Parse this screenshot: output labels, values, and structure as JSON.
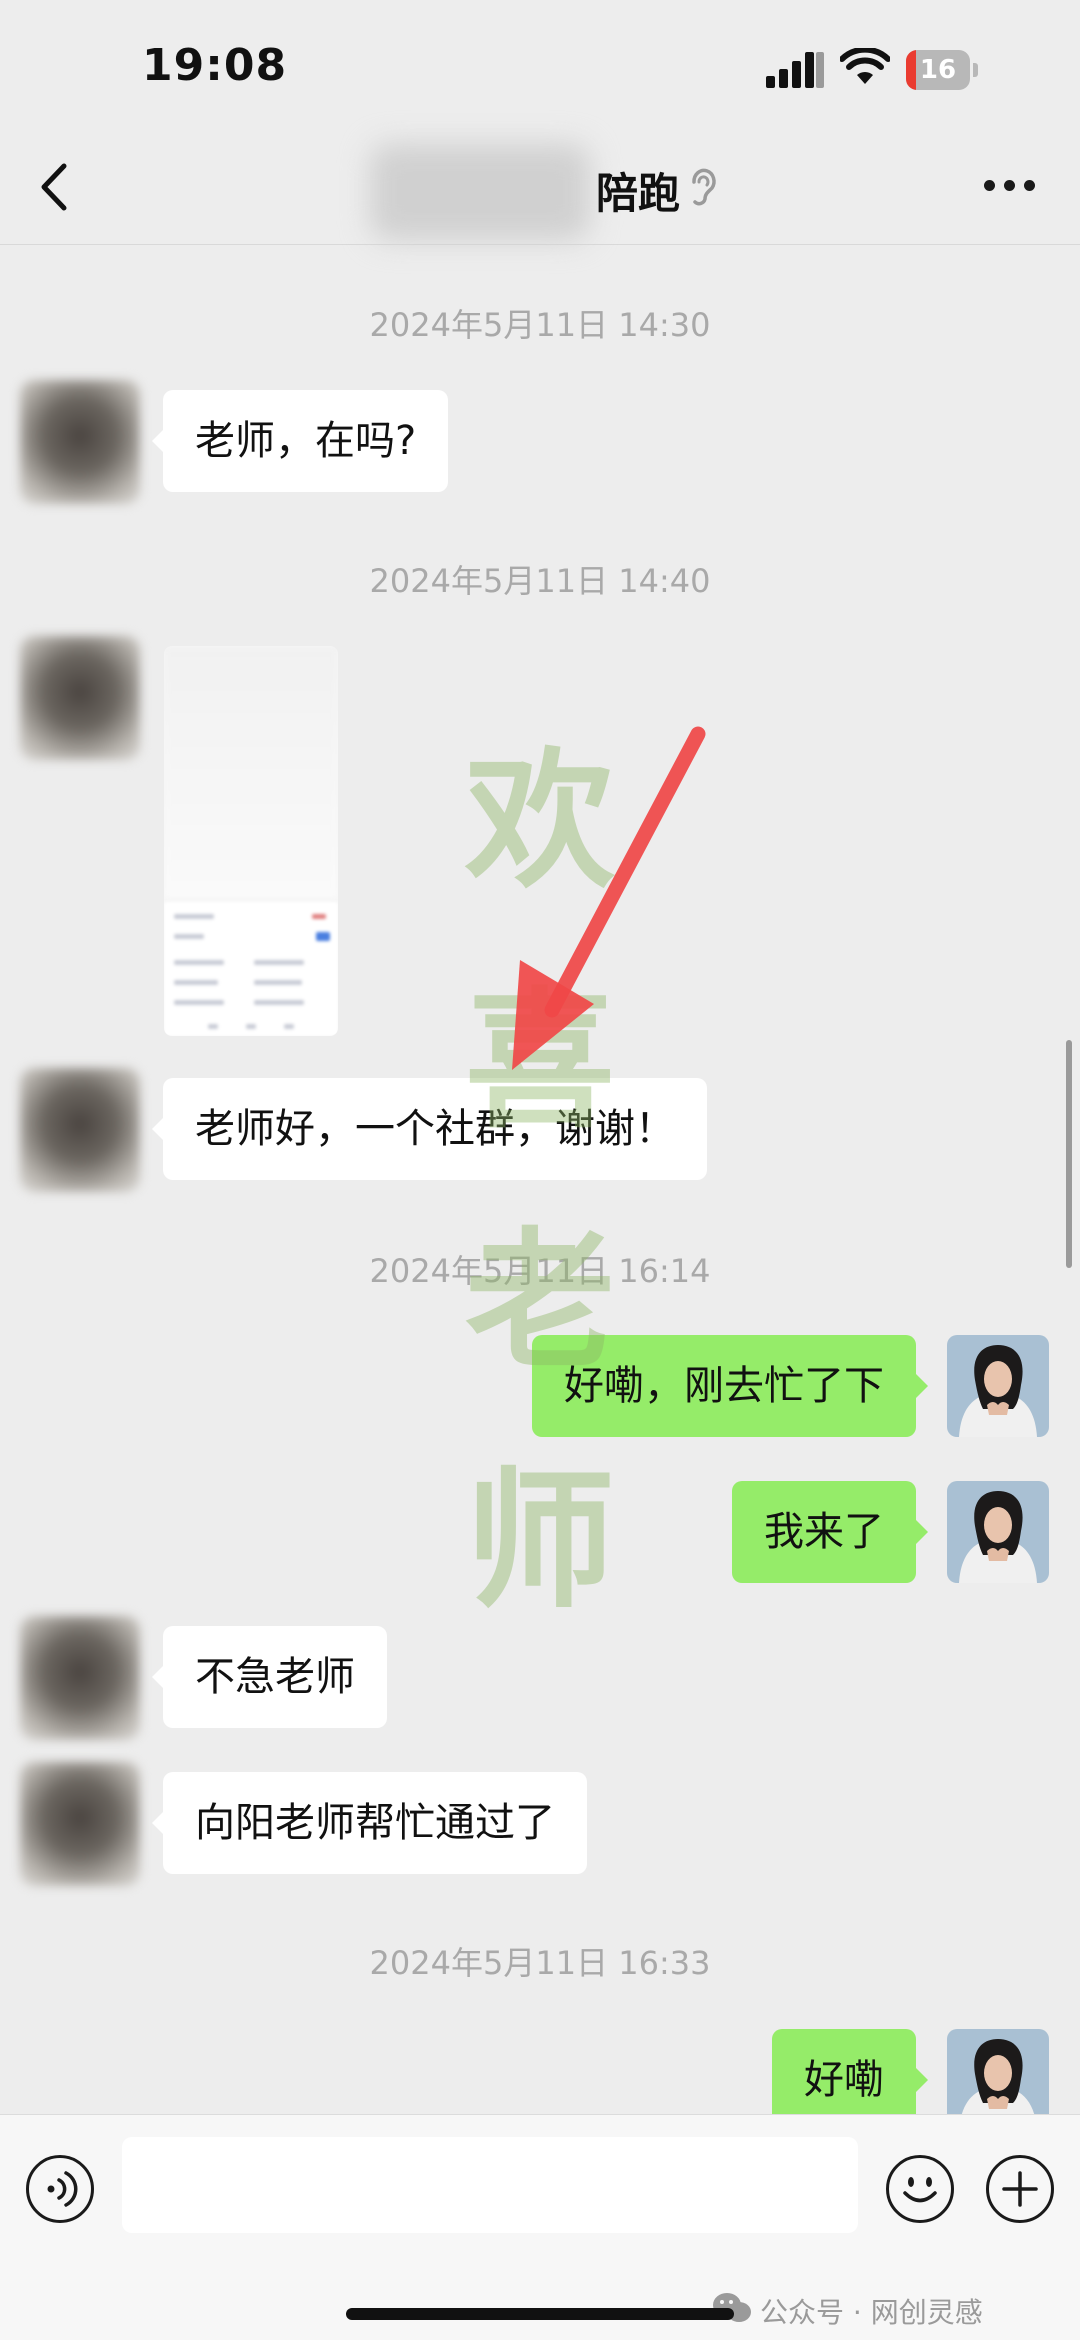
{
  "status_bar": {
    "time": "19:08",
    "battery_level": "16",
    "battery_fraction": 0.16,
    "accent_color": "#ea3b30"
  },
  "nav": {
    "title": "陪跑",
    "back_icon": "chevron-left-icon",
    "more_icon": "ellipsis-icon",
    "ear_icon": "ear-icon"
  },
  "messages": {
    "ts1": "2024年5月11日 14:30",
    "m1": "老师，在吗?",
    "ts2": "2024年5月11日 14:40",
    "m3": "老师好，一个社群，谢谢！",
    "ts3": "2024年5月11日 16:14",
    "m4": "好嘞，刚去忙了下",
    "m5": "我来了",
    "m6": "不急老师",
    "m7": "向阳老师帮忙通过了",
    "ts4": "2024年5月11日 16:33",
    "m8": "好嘞"
  },
  "watermark": {
    "c1": "欢",
    "c2": "喜",
    "c3": "老",
    "c4": "师"
  },
  "input_bar": {
    "placeholder": "",
    "voice_icon": "voice-icon",
    "emoji_icon": "emoji-icon",
    "plus_icon": "plus-icon"
  },
  "credit": "公众号 · 网创灵感",
  "colors": {
    "outgoing_bubble": "#95ec69",
    "incoming_bubble": "#ffffff",
    "background": "#ededed"
  }
}
